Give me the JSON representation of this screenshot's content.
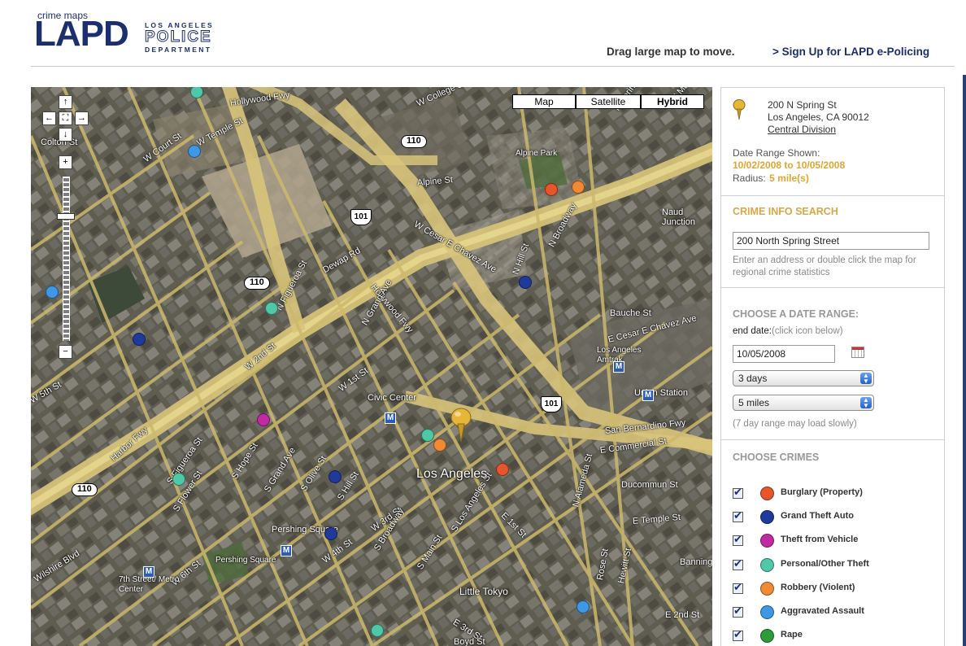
{
  "header": {
    "logo_small": "crime maps",
    "logo_big": "LAPD",
    "logo_dept_line1": "LOS ANGELES",
    "logo_dept_line2": "POLICE",
    "logo_dept_line3": "DEPARTMENT",
    "drag_hint": "Drag large map to move.",
    "signup_link": "> Sign Up for LAPD e-Policing"
  },
  "map": {
    "type_buttons": [
      {
        "label": "Map",
        "active": false
      },
      {
        "label": "Satellite",
        "active": false
      },
      {
        "label": "Hybrid",
        "active": true
      }
    ],
    "controls": {
      "up": "↑",
      "down": "↓",
      "left": "←",
      "right": "→",
      "center": "⛶",
      "zoom_in": "+",
      "zoom_out": "−"
    },
    "city_labels": [
      "Los Angeles",
      "Little Tokyo",
      "Naud Junction",
      "Civic Center",
      "Union Station",
      "Pershing Square",
      "7th Street/ Metro Center",
      "Los Angeles Amtrak",
      "Alpine Park",
      "Pershing Square"
    ],
    "road_labels": [
      "Hollywood Fwy",
      "Harbor Fwy",
      "Hollywood Fwy",
      "San Bernardino Fwy",
      "W Temple St",
      "W 1st St",
      "W 2nd St",
      "W 3rd St",
      "W 4th St",
      "W 5th St",
      "W 6th St",
      "E 1st St",
      "E 2nd St",
      "E 3rd St",
      "E Commercial St",
      "E Cesar E Chavez Ave",
      "W Cesar E Chavez Ave",
      "W College St",
      "Alpine St",
      "N Broadway",
      "N Spring St",
      "N Main St",
      "N Hill St",
      "N Grand Ave",
      "N Figueroa St",
      "S Figueroa St",
      "S Flower St",
      "S Hope St",
      "S Grand Ave",
      "S Olive St",
      "S Hill St",
      "S Broadway",
      "S Main St",
      "S Los Angeles St",
      "N Alameda St",
      "Wilshire Blvd",
      "Dewap Rd",
      "W Court St",
      "Colton St",
      "E Temple St",
      "Ducommun St",
      "Bauche St",
      "Banning",
      "Boyd St",
      "Hewitt St",
      "Rose St"
    ],
    "shields": [
      "110",
      "110",
      "110",
      "101",
      "101"
    ],
    "metro_label": "M",
    "pin_address": "200 N Spring St"
  },
  "panel": {
    "address_line1": "200 N Spring St",
    "address_line2": "Los Angeles, CA 90012",
    "division_link": "Central Division",
    "date_range_label": "Date Range Shown:",
    "date_range_value": "10/02/2008 to 10/05/2008",
    "radius_label": "Radius:",
    "radius_value": "5 mile(s)",
    "search_heading": "CRIME INFO SEARCH",
    "search_value": "200 North Spring Street",
    "search_hint": "Enter an address or double click the map for regional crime statistics",
    "date_heading": "CHOOSE A DATE RANGE:",
    "end_date_label": "end date:",
    "end_date_hint": "(click icon below)",
    "end_date_value": "10/05/2008",
    "days_select": "3 days",
    "miles_select": "5 miles",
    "slow_hint": "(7 day range may load slowly)",
    "crimes_heading": "CHOOSE CRIMES",
    "crimes": [
      {
        "label": "Burglary (Property)",
        "color": "#e8542b",
        "checked": true
      },
      {
        "label": "Grand Theft Auto",
        "color": "#1f3a9b",
        "checked": true
      },
      {
        "label": "Theft from Vehicle",
        "color": "#c22aa3",
        "checked": true
      },
      {
        "label": "Personal/Other Theft",
        "color": "#4fc8a8",
        "checked": true
      },
      {
        "label": "Robbery (Violent)",
        "color": "#f08a35",
        "checked": true
      },
      {
        "label": "Aggravated Assault",
        "color": "#3d98e6",
        "checked": true
      },
      {
        "label": "Rape",
        "color": "#2d9a3b",
        "checked": true
      }
    ]
  }
}
